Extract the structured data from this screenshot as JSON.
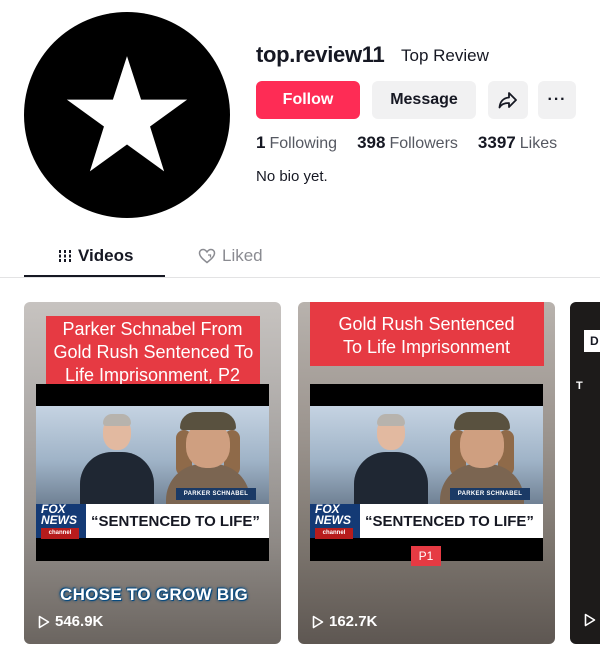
{
  "profile": {
    "username": "top.review11",
    "nickname": "Top Review",
    "bio": "No bio yet."
  },
  "actions": {
    "follow_label": "Follow",
    "message_label": "Message",
    "share_icon": "share-icon",
    "more_label": "···"
  },
  "stats": {
    "following": {
      "count": "1",
      "label": "Following"
    },
    "followers": {
      "count": "398",
      "label": "Followers"
    },
    "likes": {
      "count": "3397",
      "label": "Likes"
    }
  },
  "tabs": [
    {
      "label": "Videos",
      "icon": "grid-icon",
      "active": true
    },
    {
      "label": "Liked",
      "icon": "liked-heart-icon",
      "active": false
    }
  ],
  "videos": [
    {
      "caption": "Parker Schnabel From\nGold Rush Sentenced To\nLife Imprisonment, P2",
      "nameplate": "PARKER SCHNABEL",
      "channel_logo": "FOX\nNEWS",
      "channel_sub": "channel",
      "headline": "“SENTENCED TO LIFE”",
      "overlay_text": "CHOSE TO GROW BIG",
      "views": "546.9K"
    },
    {
      "caption": "Gold Rush Sentenced\nTo Life Imprisonment",
      "nameplate": "PARKER SCHNABEL",
      "channel_logo": "FOX\nNEWS",
      "channel_sub": "channel",
      "headline": "“SENTENCED TO LIFE”",
      "badge": "P1",
      "views": "162.7K"
    },
    {
      "box_text": "D",
      "corner_text": "T",
      "views": ""
    }
  ],
  "colors": {
    "accent": "#fe2c55",
    "caption_red": "#e63a43",
    "fox_blue": "#143a75"
  }
}
